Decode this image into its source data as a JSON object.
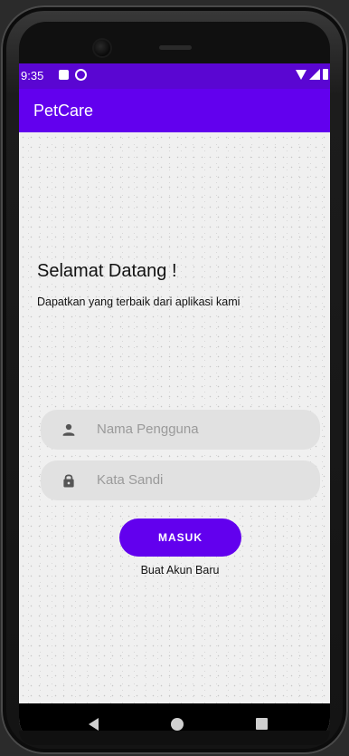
{
  "status_bar": {
    "time": "9:35",
    "icons_left": [
      "sim-card-icon",
      "sync-icon"
    ],
    "icons_right": [
      "wifi-icon",
      "signal-icon",
      "battery-icon"
    ]
  },
  "app_bar": {
    "title": "PetCare",
    "color": "#6200ee"
  },
  "login": {
    "heading": "Selamat Datang !",
    "subtitle": "Dapatkan yang terbaik dari aplikasi kami",
    "username_placeholder": "Nama Pengguna",
    "password_placeholder": "Kata Sandi",
    "username_icon": "person-icon",
    "password_icon": "lock-icon",
    "submit_label": "MASUK",
    "create_account_label": "Buat Akun Baru"
  },
  "nav_bar": {
    "buttons": [
      "back-icon",
      "home-icon",
      "recents-icon"
    ]
  }
}
